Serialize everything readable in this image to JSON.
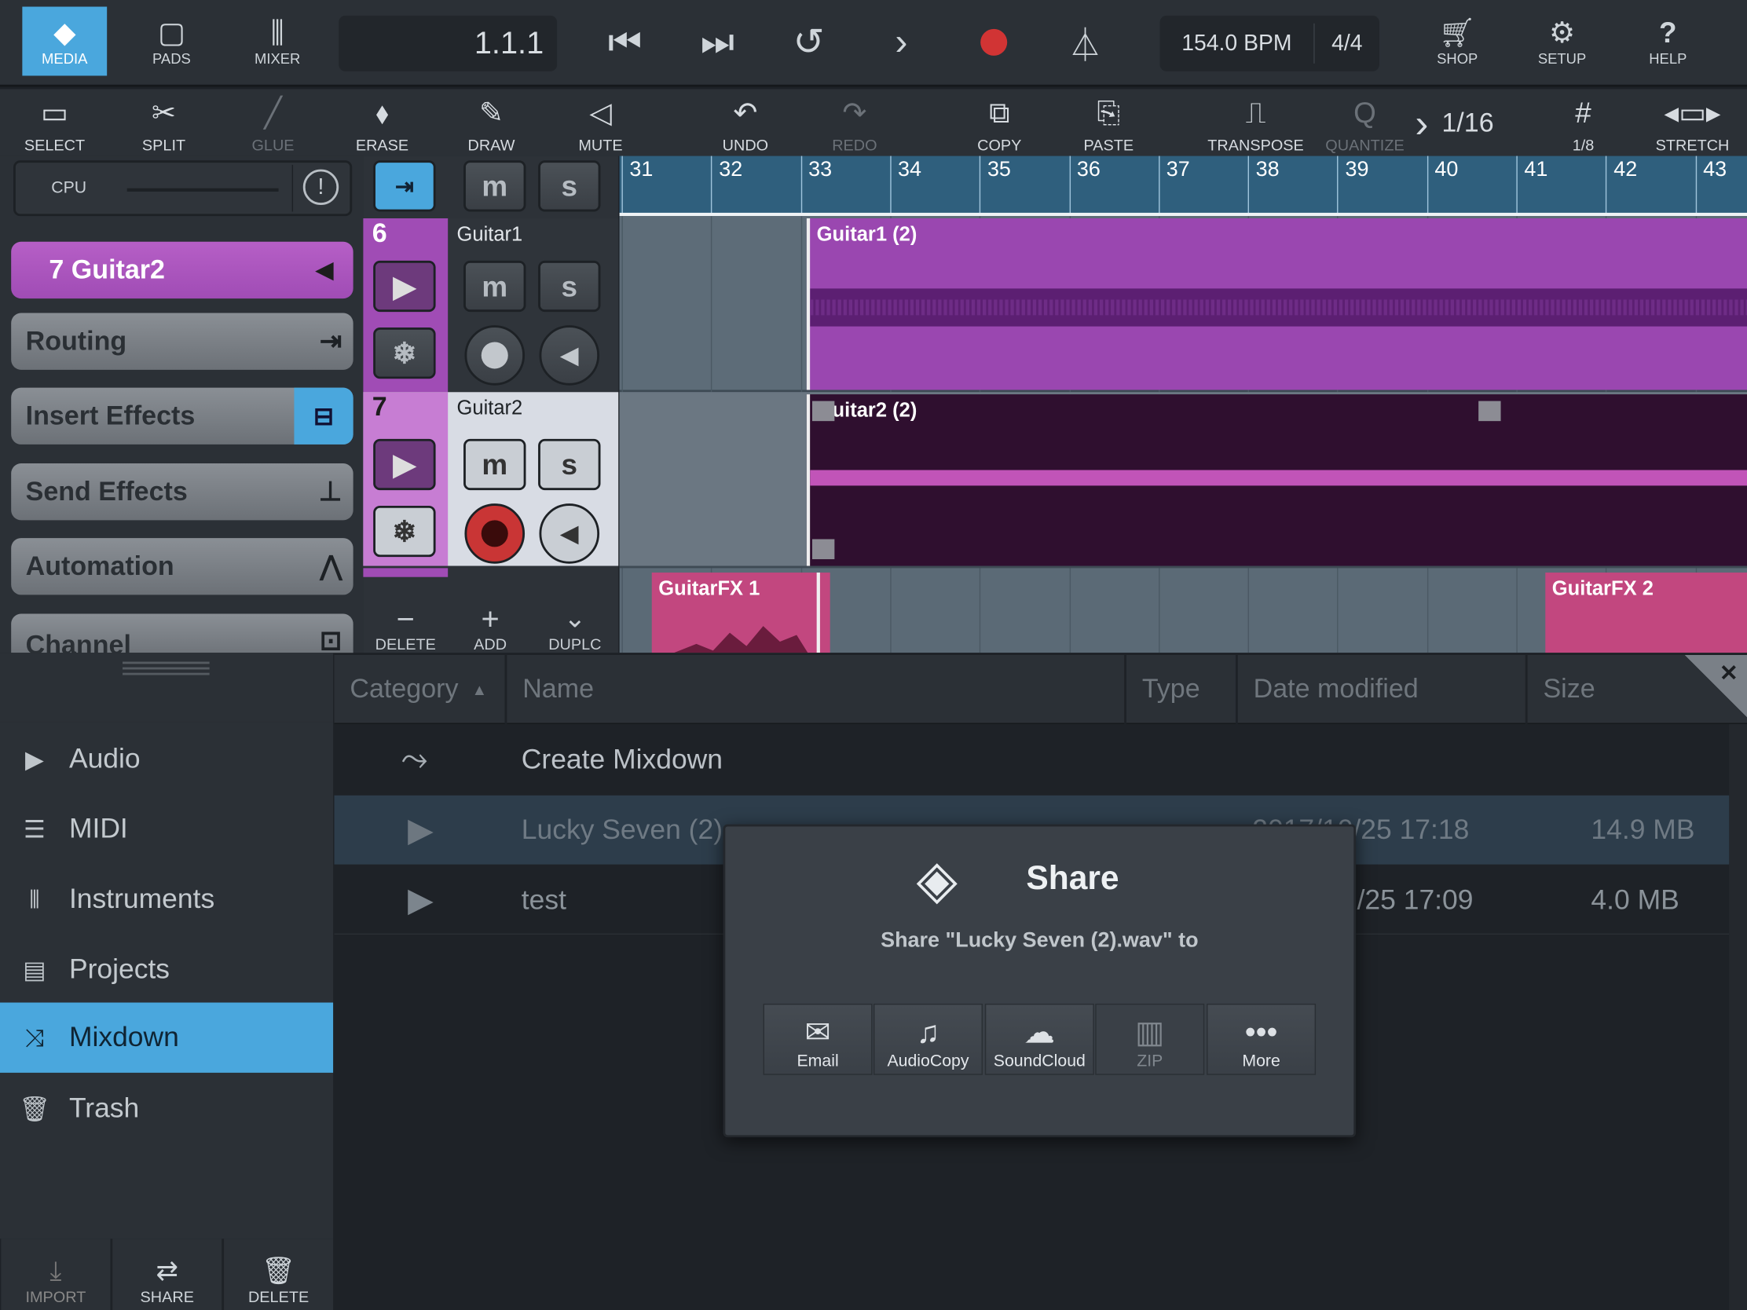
{
  "topbar": {
    "media": "MEDIA",
    "pads": "PADS",
    "mixer": "MIXER",
    "position": "1.1.1",
    "tempo": "154.0 BPM",
    "signature": "4/4",
    "shop": "SHOP",
    "setup": "SETUP",
    "help": "HELP"
  },
  "tools": {
    "select": "SELECT",
    "split": "SPLIT",
    "glue": "GLUE",
    "erase": "ERASE",
    "draw": "DRAW",
    "mute": "MUTE",
    "undo": "UNDO",
    "redo": "REDO",
    "copy": "COPY",
    "paste": "PASTE",
    "transpose": "TRANSPOSE",
    "quantize": "QUANTIZE",
    "quantize_value": "1/16",
    "grid_value": "1/8",
    "stretch": "STRETCH"
  },
  "left_panel": {
    "cpu": "CPU",
    "selected_track": "7  Guitar2",
    "routing": "Routing",
    "insert_effects": "Insert Effects",
    "send_effects": "Send Effects",
    "automation": "Automation",
    "channel": "Channel"
  },
  "tracks": {
    "t6_num": "6",
    "t6_name": "Guitar1",
    "t7_num": "7",
    "t7_name": "Guitar2",
    "m": "m",
    "s": "s",
    "delete": "DELETE",
    "add": "ADD",
    "duplicate": "DUPLC"
  },
  "ruler": [
    "31",
    "32",
    "33",
    "34",
    "35",
    "36",
    "37",
    "38",
    "39",
    "40",
    "41",
    "42",
    "43"
  ],
  "clips": {
    "guitar1": "Guitar1 (2)",
    "guitar2": "Guitar2 (2)",
    "fx1": "GuitarFX 1",
    "fx2": "GuitarFX 2"
  },
  "browser": {
    "columns": {
      "category": "Category",
      "name": "Name",
      "type": "Type",
      "date": "Date modified",
      "size": "Size"
    },
    "categories": [
      "Audio",
      "MIDI",
      "Instruments",
      "Projects",
      "Mixdown",
      "Trash"
    ],
    "rows": [
      {
        "name": "Create Mixdown"
      },
      {
        "name": "Lucky Seven (2)",
        "date": "2017/10/25 17:18",
        "size": "14.9 MB"
      },
      {
        "name": "test",
        "date": "/25 17:09",
        "size": "4.0 MB"
      }
    ],
    "import": "IMPORT",
    "share": "SHARE",
    "delete": "DELETE"
  },
  "share_dialog": {
    "title": "Share",
    "subtitle": "Share \"Lucky Seven (2).wav\" to",
    "options": [
      "Email",
      "AudioCopy",
      "SoundCloud",
      "ZIP",
      "More"
    ]
  },
  "colors": {
    "accent": "#4aa7dd",
    "track_purple": "#a04cb5",
    "record": "#c93535"
  }
}
